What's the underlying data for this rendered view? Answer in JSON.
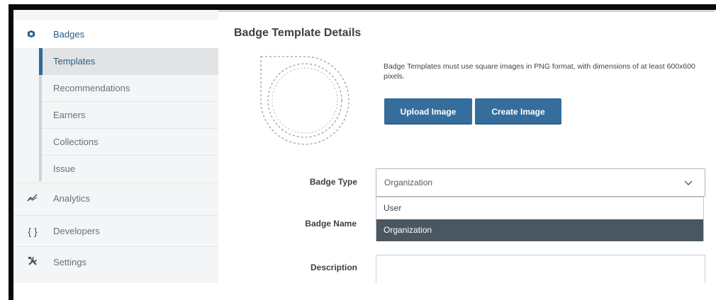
{
  "sidebar": {
    "badges_label": "Badges",
    "sub_items": [
      "Templates",
      "Recommendations",
      "Earners",
      "Collections",
      "Issue"
    ],
    "analytics_label": "Analytics",
    "developers_label": "Developers",
    "settings_label": "Settings",
    "developers_icon": "{ }"
  },
  "main": {
    "title": "Badge Template Details",
    "image_help": "Badge Templates must use square images in PNG format, with dimensions of at least 600x600 pixels.",
    "upload_button": "Upload Image",
    "create_button": "Create Image",
    "badge_type_label": "Badge Type",
    "badge_type_value": "Organization",
    "badge_type_options": [
      "User",
      "Organization"
    ],
    "badge_name_label": "Badge Name",
    "description_label": "Description"
  },
  "colors": {
    "accent": "#356e9c",
    "active_text": "#2b5d86",
    "dropdown_highlight": "#4a5660",
    "sidebar_bg": "#f4f5f6"
  },
  "icons": {
    "badges": "badge-icon",
    "analytics": "analytics-icon",
    "developers": "braces-icon",
    "settings": "tools-icon",
    "select": "chevron-down-icon"
  }
}
